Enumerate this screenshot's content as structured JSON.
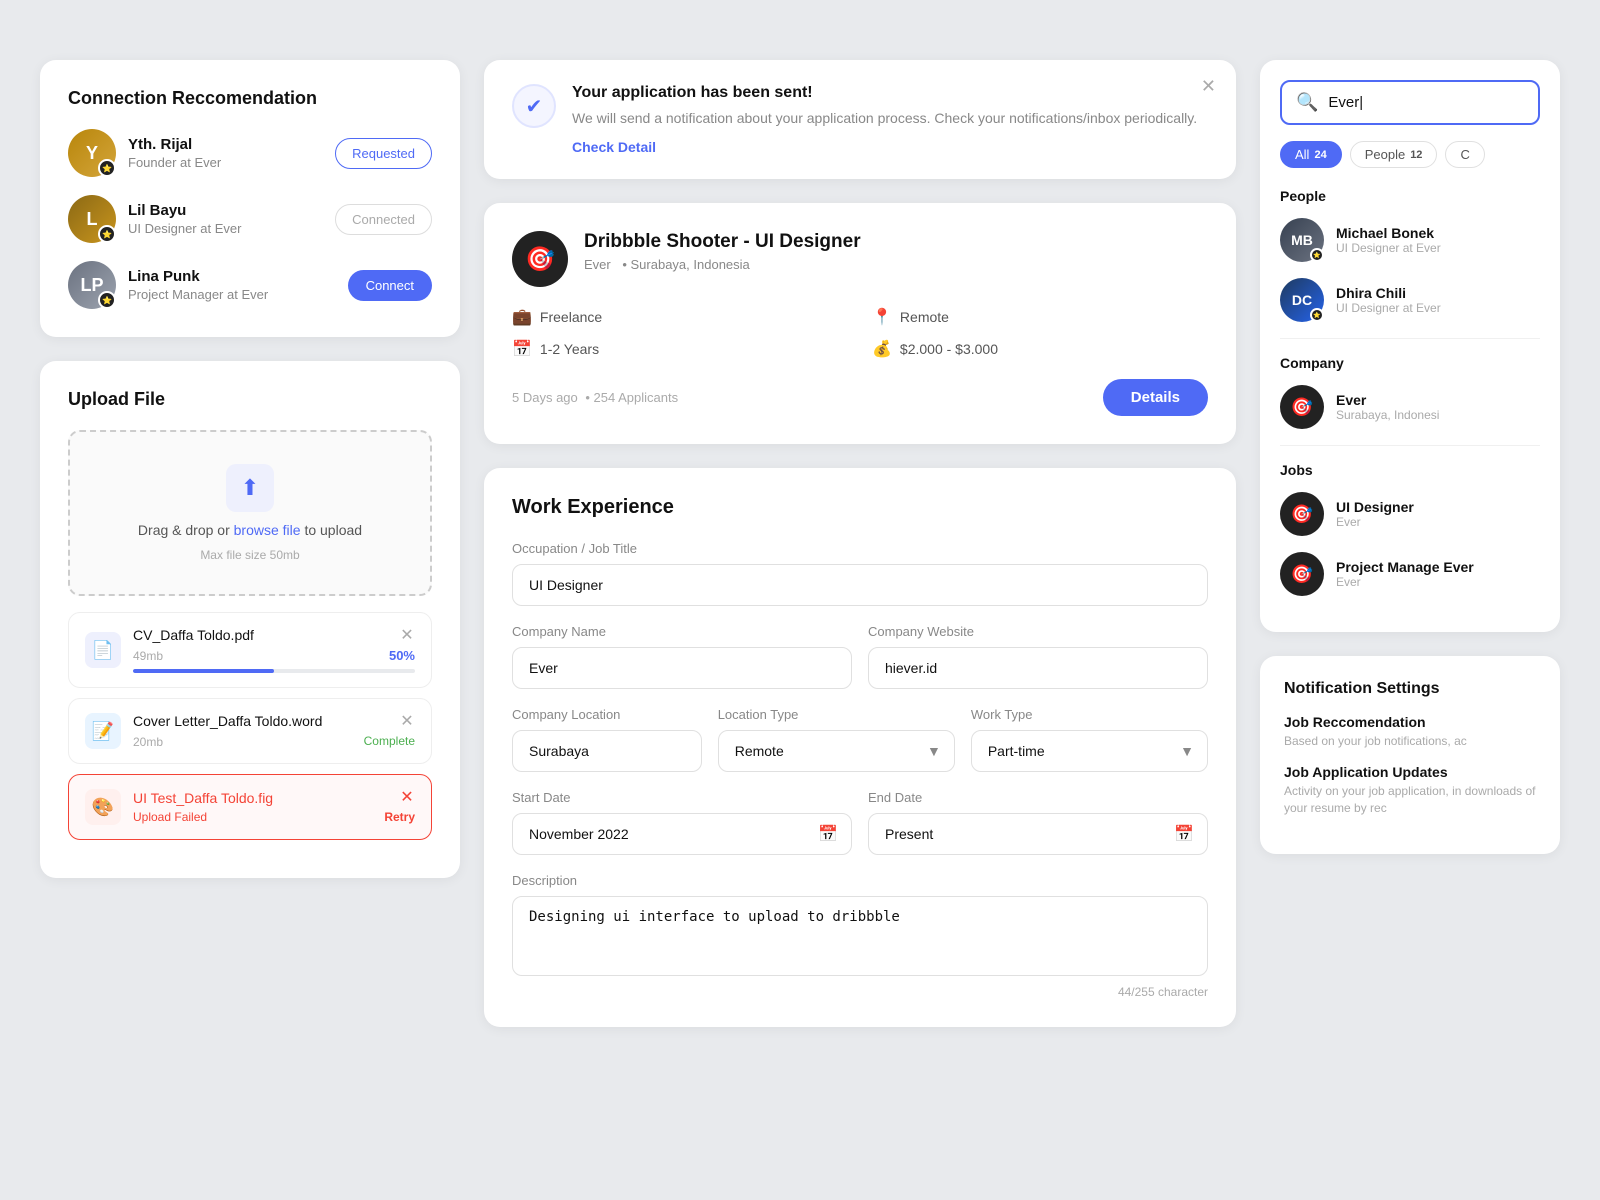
{
  "connectionCard": {
    "title": "Connection Reccomendation",
    "connections": [
      {
        "name": "Yth. Rijal",
        "role": "Founder at Ever",
        "avatarText": "Y",
        "avatarClass": "avatar-bg1",
        "buttonType": "requested",
        "buttonLabel": "Requested"
      },
      {
        "name": "Lil Bayu",
        "role": "UI Designer at Ever",
        "avatarText": "L",
        "avatarClass": "avatar-bg2",
        "buttonType": "connected",
        "buttonLabel": "Connected"
      },
      {
        "name": "Lina Punk",
        "role": "Project Manager at Ever",
        "avatarText": "LP",
        "avatarClass": "avatar-bg3",
        "buttonType": "connect",
        "buttonLabel": "Connect"
      }
    ]
  },
  "uploadCard": {
    "title": "Upload File",
    "dropzoneText": "Drag & drop or",
    "browseText": "browse file",
    "dropzoneSubText": "to upload",
    "maxFileText": "Max file size 50mb",
    "files": [
      {
        "name": "CV_Daffa Toldo.pdf",
        "size": "49mb",
        "status": "uploading",
        "percent": "50%",
        "progress": 50,
        "iconClass": "pdf",
        "hasError": false
      },
      {
        "name": "Cover Letter_Daffa Toldo.word",
        "size": "20mb",
        "status": "complete",
        "statusText": "Complete",
        "iconClass": "word",
        "hasError": false
      },
      {
        "name": "UI Test_Daffa Toldo.fig",
        "size": "",
        "status": "error",
        "statusText": "Upload Failed",
        "retryText": "Retry",
        "iconClass": "fig",
        "hasError": true
      }
    ]
  },
  "banner": {
    "title": "Your application has been sent!",
    "text": "We will send a notification about your application process. Check your notifications/inbox periodically.",
    "linkText": "Check Detail"
  },
  "jobCard": {
    "logoEmoji": "🎯",
    "title": "Dribbble Shooter - UI Designer",
    "company": "Ever",
    "location": "Surabaya, Indonesia",
    "detail1Label": "Freelance",
    "detail2Label": "1-2 Years",
    "detail3Label": "Remote",
    "detail4Label": "$2.000 - $3.000",
    "postedTime": "5 Days ago",
    "applicants": "254 Applicants",
    "detailsButton": "Details"
  },
  "workExperience": {
    "title": "Work Experience",
    "fields": {
      "occupationLabel": "Occupation / Job Title",
      "occupationValue": "UI Designer",
      "companyNameLabel": "Company Name",
      "companyNameValue": "Ever",
      "companyWebsiteLabel": "Company Website",
      "companyWebsiteValue": "hiever.id",
      "companyLocationLabel": "Company Location",
      "companyLocationValue": "Surabaya",
      "locationTypeLabel": "Location Type",
      "locationTypeValue": "Remote",
      "workTypeLabel": "Work Type",
      "workTypeValue": "Part-time",
      "startDateLabel": "Start Date",
      "startDateValue": "November 2022",
      "endDateLabel": "End Date",
      "endDateValue": "Present",
      "descriptionLabel": "Description",
      "descriptionValue": "Designing ui interface to upload to dribbble",
      "charCount": "44/255 character"
    }
  },
  "searchPanel": {
    "searchValue": "Ever|",
    "filters": [
      {
        "label": "All",
        "count": "24",
        "active": true
      },
      {
        "label": "People",
        "count": "12",
        "active": false
      },
      {
        "label": "C",
        "count": "",
        "active": false
      }
    ],
    "peopleSection": {
      "title": "People",
      "results": [
        {
          "name": "Michael Bonek",
          "role": "UI Designer at Ever",
          "avatarText": "MB",
          "avatarClass": "avatar-search1"
        },
        {
          "name": "Dhira Chili",
          "role": "UI Designer at Ever",
          "avatarText": "DC",
          "avatarClass": "avatar-search2"
        }
      ]
    },
    "companySection": {
      "title": "Company",
      "results": [
        {
          "name": "Ever",
          "location": "Surabaya, Indonesi",
          "logoEmoji": "🎯"
        }
      ]
    },
    "jobsSection": {
      "title": "Jobs",
      "results": [
        {
          "title": "UI Designer",
          "company": "Ever",
          "logoEmoji": "🎯"
        },
        {
          "title": "Project Manage Ever",
          "company": "Ever",
          "logoEmoji": "🎯"
        }
      ]
    }
  },
  "notifSettings": {
    "title": "Notification Settings",
    "items": [
      {
        "title": "Job Reccomendation",
        "desc": "Based on your job notifications, ac"
      },
      {
        "title": "Job Application Updates",
        "desc": "Activity on your job application, in downloads of your resume by rec"
      }
    ]
  }
}
